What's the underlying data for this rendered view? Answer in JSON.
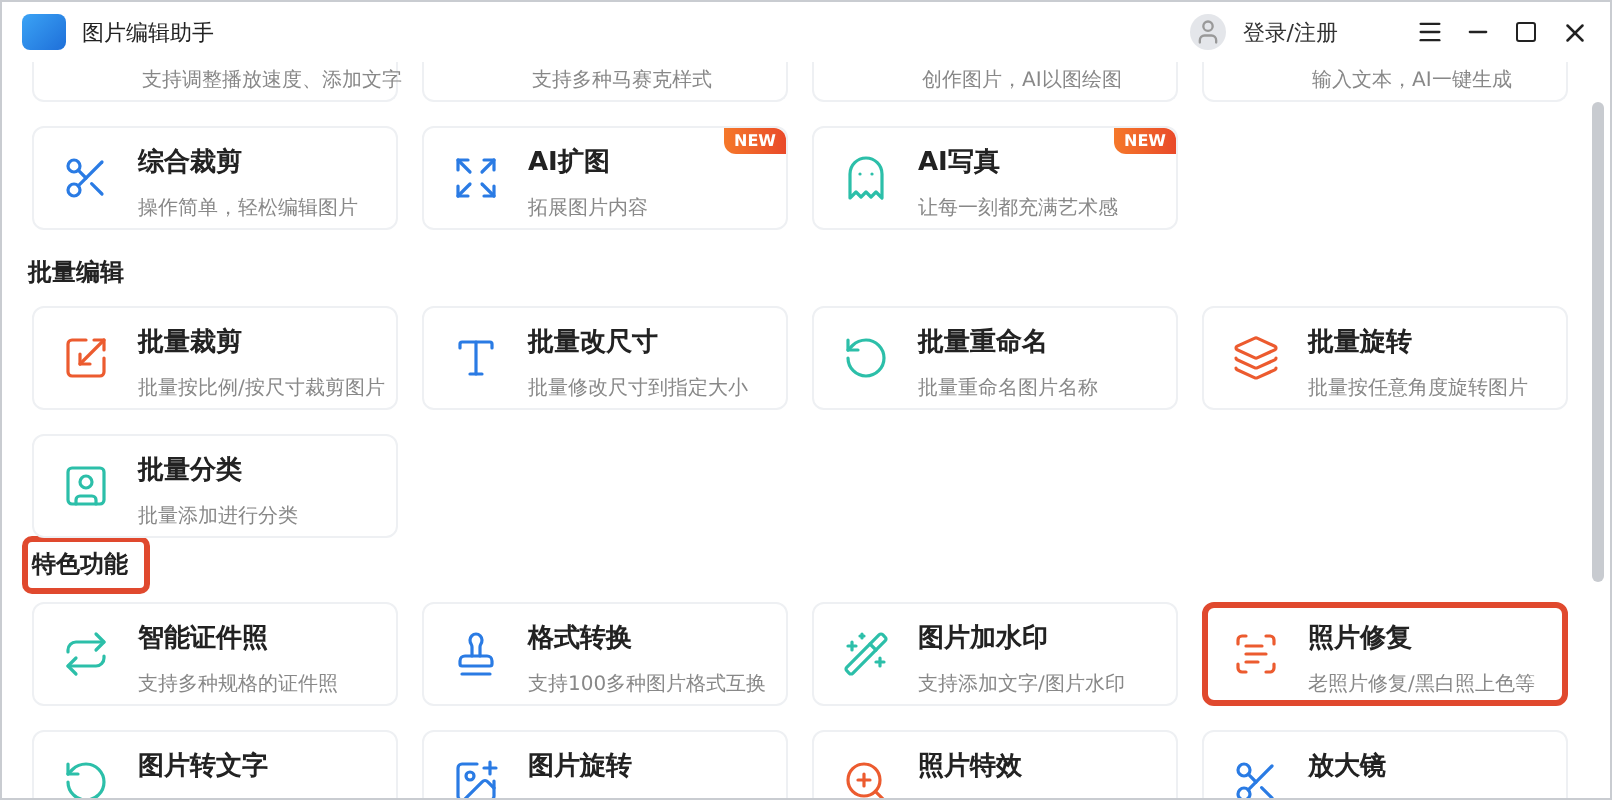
{
  "window": {
    "title": "图片编辑助手",
    "account": "登录/注册"
  },
  "top_row": [
    {
      "desc": "支持调整播放速度、添加文字"
    },
    {
      "desc": "支持多种马赛克样式"
    },
    {
      "desc": "创作图片，AI以图绘图"
    },
    {
      "desc": "输入文本，AI一键生成"
    }
  ],
  "cards_row": [
    {
      "title": "综合裁剪",
      "desc": "操作简单，轻松编辑图片"
    },
    {
      "title": "AI扩图",
      "desc": "拓展图片内容",
      "badge": "NEW"
    },
    {
      "title": "AI写真",
      "desc": "让每一刻都充满艺术感",
      "badge": "NEW"
    }
  ],
  "sections": [
    {
      "heading": "批量编辑",
      "highlighted": false,
      "cards": [
        {
          "title": "批量裁剪",
          "desc": "批量按比例/按尺寸裁剪图片",
          "highlighted": false
        },
        {
          "title": "批量改尺寸",
          "desc": "批量修改尺寸到指定大小",
          "highlighted": false
        },
        {
          "title": "批量重命名",
          "desc": "批量重命名图片名称",
          "highlighted": false
        },
        {
          "title": "批量旋转",
          "desc": "批量按任意角度旋转图片",
          "highlighted": false
        },
        {
          "title": "批量分类",
          "desc": "批量添加进行分类",
          "highlighted": false
        }
      ]
    },
    {
      "heading": "特色功能",
      "highlighted": true,
      "cards": [
        {
          "title": "智能证件照",
          "desc": "支持多种规格的证件照",
          "highlighted": false
        },
        {
          "title": "格式转换",
          "desc": "支持100多种图片格式互换",
          "highlighted": false
        },
        {
          "title": "图片加水印",
          "desc": "支持添加文字/图片水印",
          "highlighted": false
        },
        {
          "title": "照片修复",
          "desc": "老照片修复/黑白照上色等",
          "highlighted": true
        },
        {
          "title": "图片转文字",
          "highlighted": false
        },
        {
          "title": "图片旋转",
          "highlighted": false
        },
        {
          "title": "照片特效",
          "highlighted": false
        },
        {
          "title": "放大镜",
          "highlighted": false
        }
      ]
    }
  ]
}
